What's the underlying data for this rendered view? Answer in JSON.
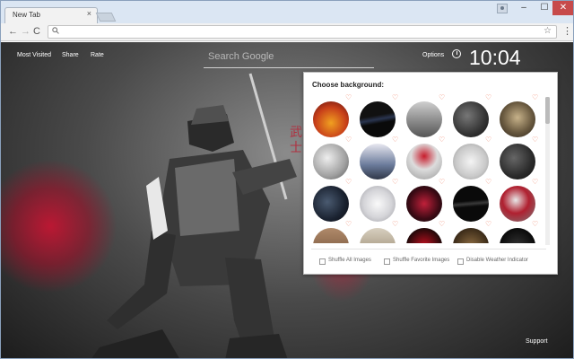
{
  "browser": {
    "tab_title": "New Tab",
    "tab_close": "×",
    "window_min": "–",
    "window_max": "☐",
    "window_close": "✕",
    "nav_back": "←",
    "nav_forward": "→",
    "nav_reload": "C",
    "menu": "⋮",
    "star": "☆",
    "search_glyph": "🔍"
  },
  "page": {
    "links": [
      "Most Visited",
      "Share",
      "Rate"
    ],
    "search_placeholder": "Search Google",
    "options_label": "Options",
    "time": "10:04",
    "support_label": "Support"
  },
  "panel": {
    "title": "Choose background:",
    "thumbnail_count": 25,
    "options": [
      "Shuffle All Images",
      "Shuffle Favorite Images",
      "Disable Weather Indicator"
    ]
  },
  "colors": {
    "heart": "#f0856b",
    "accent_red": "#c8143c"
  }
}
